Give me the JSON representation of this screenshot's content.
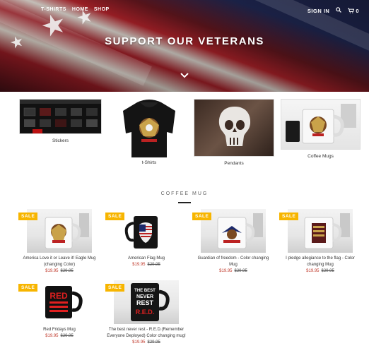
{
  "nav": {
    "left_items": [
      "T-SHIRTS",
      "HOME",
      "SHOP"
    ],
    "sign_in": "SIGN IN",
    "cart_count": "0"
  },
  "hero": {
    "title": "SUPPORT OUR VETERANS"
  },
  "categories": [
    {
      "label": "Stickers"
    },
    {
      "label": "t-Shirts"
    },
    {
      "label": "Pendants"
    },
    {
      "label": "Coffee Mugs"
    }
  ],
  "section": {
    "title": "COFFEE MUG"
  },
  "products": [
    {
      "name": "America Love it or Leave it! Eagle Mug (changing Color)",
      "price": "$19.95",
      "old_price": "$29.95",
      "badge": "SALE"
    },
    {
      "name": "American Flag Mug",
      "price": "$19.95",
      "old_price": "$29.95",
      "badge": "SALE"
    },
    {
      "name": "Guardian of freedom - Color changing Mug",
      "price": "$19.95",
      "old_price": "$29.95",
      "badge": "SALE"
    },
    {
      "name": "I pledge allegiance to the flag - Color changing Mug",
      "price": "$19.95",
      "old_price": "$29.95",
      "badge": "SALE"
    },
    {
      "name": "Red Fridays Mug",
      "price": "$19.95",
      "old_price": "$29.95",
      "badge": "SALE"
    },
    {
      "name": "The best never rest - R.E.D.(Remember Everyone Deployed) Color changing mug!",
      "price": "$19.95",
      "old_price": "$29.95",
      "badge": "SALE"
    }
  ],
  "mug_texts": {
    "red": "RED",
    "best": [
      "THE BEST",
      "NEVER",
      "REST",
      "R.E.D."
    ]
  },
  "colors": {
    "sale_badge": "#f7b500",
    "price_red": "#c0392b"
  }
}
